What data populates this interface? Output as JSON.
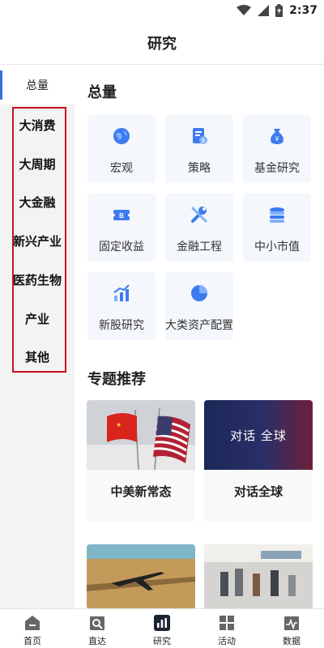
{
  "status_bar": {
    "time": "2:37"
  },
  "header": {
    "title": "研究"
  },
  "sidebar": {
    "items": [
      {
        "label": "总量",
        "active": true
      },
      {
        "label": "大消费"
      },
      {
        "label": "大周期"
      },
      {
        "label": "大金融"
      },
      {
        "label": "新兴产业"
      },
      {
        "label": "医药生物"
      },
      {
        "label": "产业"
      },
      {
        "label": "其他"
      }
    ],
    "highlight_color": "#c8101e"
  },
  "main": {
    "section_title": "总量",
    "tiles": [
      {
        "label": "宏观",
        "icon": "globe-icon"
      },
      {
        "label": "策略",
        "icon": "document-icon"
      },
      {
        "label": "基金研究",
        "icon": "money-bag-icon"
      },
      {
        "label": "固定收益",
        "icon": "ticket-icon"
      },
      {
        "label": "金融工程",
        "icon": "wrench-icon"
      },
      {
        "label": "中小市值",
        "icon": "coin-stack-icon"
      },
      {
        "label": "新股研究",
        "icon": "bar-chart-icon"
      },
      {
        "label": "大类资产配置",
        "icon": "pie-chart-icon"
      }
    ],
    "topics_title": "专题推荐",
    "topics": [
      {
        "title": "中美新常态",
        "image": "flags-image"
      },
      {
        "title": "对话全球",
        "image": "dialogue-global-image",
        "image_text": "对话 全球"
      },
      {
        "title": "",
        "image": "airplane-image"
      },
      {
        "title": "",
        "image": "airport-image"
      }
    ]
  },
  "bottom_nav": {
    "items": [
      {
        "label": "首页",
        "icon": "home-icon"
      },
      {
        "label": "直达",
        "icon": "search-box-icon"
      },
      {
        "label": "研究",
        "icon": "research-chart-icon",
        "active": true
      },
      {
        "label": "活动",
        "icon": "grid-icon"
      },
      {
        "label": "数据",
        "icon": "data-wave-icon"
      }
    ]
  },
  "colors": {
    "accent": "#3d6fd9",
    "tile_bg": "#f4f7fb",
    "sidebar_bg": "#f3f3f3"
  }
}
